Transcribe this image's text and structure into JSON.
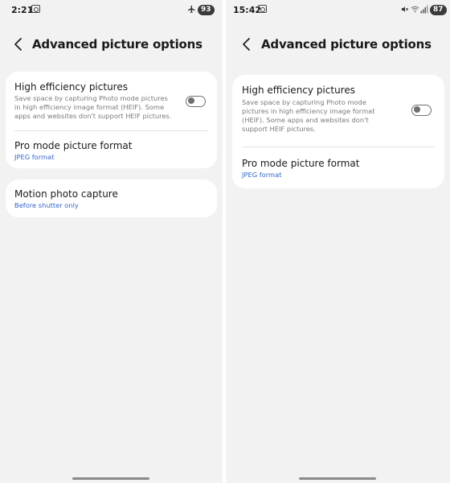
{
  "left_screen": {
    "status_bar": {
      "time": "2:21",
      "battery": "93",
      "icons": [
        "screenshot-icon",
        "airplane-icon"
      ]
    },
    "app_bar": {
      "title": "Advanced picture options",
      "back_icon": "chevron-left-icon"
    },
    "settings_card": {
      "high_efficiency": {
        "title": "High efficiency pictures",
        "description": "Save space by capturing Photo mode pictures in high efficiency image format (HEIF). Some apps and websites don't support HEIF pictures.",
        "toggle_on": false
      },
      "pro_mode": {
        "title": "Pro mode picture format",
        "value": "JPEG format"
      }
    },
    "motion_card": {
      "motion_photo": {
        "title": "Motion photo capture",
        "value": "Before shutter only"
      }
    }
  },
  "right_screen": {
    "status_bar": {
      "time": "15:42",
      "battery": "87",
      "icons": [
        "screenshot-icon",
        "mute-icon",
        "wifi-icon",
        "signal-icon"
      ]
    },
    "app_bar": {
      "title": "Advanced picture options",
      "back_icon": "chevron-left-icon"
    },
    "settings_card": {
      "high_efficiency": {
        "title": "High efficiency pictures",
        "description": "Save space by capturing Photo mode pictures in high efficiency image format (HEIF). Some apps and websites don't support HEIF pictures.",
        "toggle_on": false
      },
      "pro_mode": {
        "title": "Pro mode picture format",
        "value": "JPEG format"
      }
    }
  },
  "colors": {
    "background": "#f2f2f2",
    "card": "#ffffff",
    "accent_link": "#3367c8",
    "secondary_text": "#7a7a7a",
    "primary_text": "#1a1a1a"
  }
}
